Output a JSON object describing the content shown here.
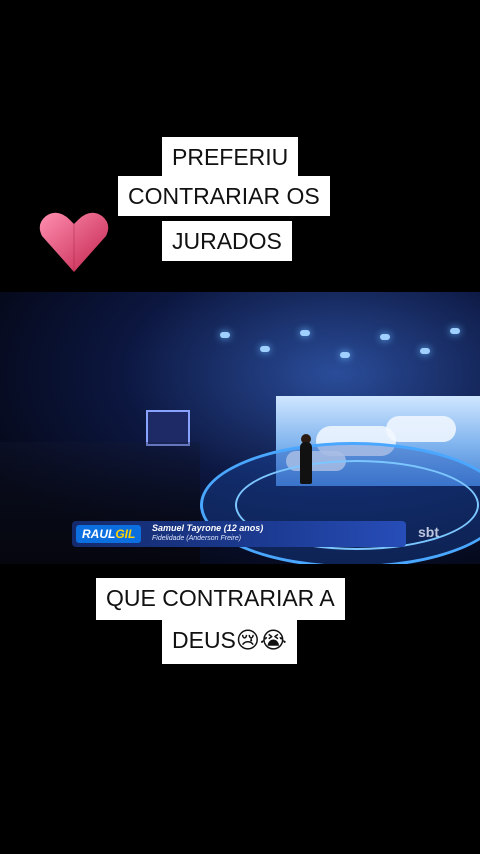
{
  "caption_top": {
    "lines": [
      "PREFERIU",
      "CONTRARIAR OS",
      "JURADOS"
    ]
  },
  "caption_bottom": {
    "lines": [
      "QUE CONTRARIAR A",
      "DEUS😢😭"
    ]
  },
  "heart_color": "#e8456b",
  "video": {
    "show_logo_a": "RAUL",
    "show_logo_b": "GIL",
    "performer": "Samuel Tayrone (12 anos)",
    "song": "Fidelidade",
    "composer": "(Anderson Freire)",
    "channel": "sbt"
  }
}
